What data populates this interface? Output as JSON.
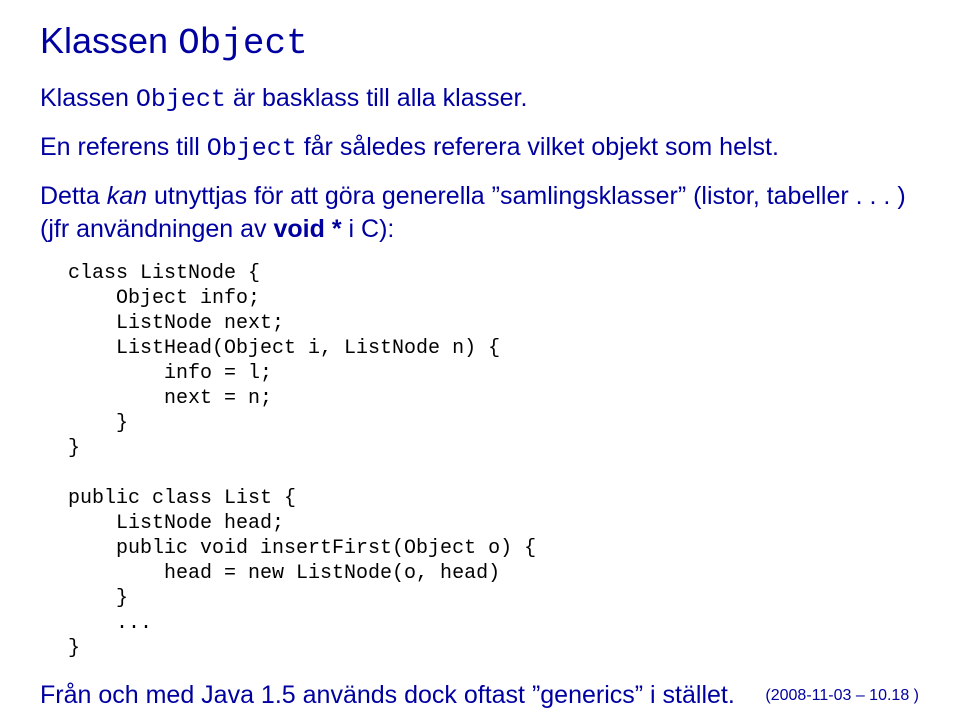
{
  "title_prefix": "Klassen ",
  "title_mono": "Object",
  "line1_a": "Klassen ",
  "line1_mono": "Object",
  "line1_b": " är basklass till alla klasser.",
  "line2_a": "En referens till ",
  "line2_mono": "Object",
  "line2_b": " får således referera vilket objekt som helst.",
  "line3_a": "Detta ",
  "line3_ital": "kan",
  "line3_b": " utnyttjas för att göra generella ”samlingsklasser” (listor, tabeller . . . ) (jfr användningen av ",
  "line3_bold": "void *",
  "line3_c": " i C):",
  "code1": "class ListNode {\n    Object info;\n    ListNode next;\n    ListHead(Object i, ListNode n) {\n        info = l;\n        next = n;\n    }\n}\n\npublic class List {\n    ListNode head;\n    public void insertFirst(Object o) {\n        head = new ListNode(o, head)\n    }\n    ...\n}",
  "line4": "Från och med Java 1.5 används dock oftast ”generics” i stället.",
  "footer": "(2008-11-03 – 10.18 )"
}
